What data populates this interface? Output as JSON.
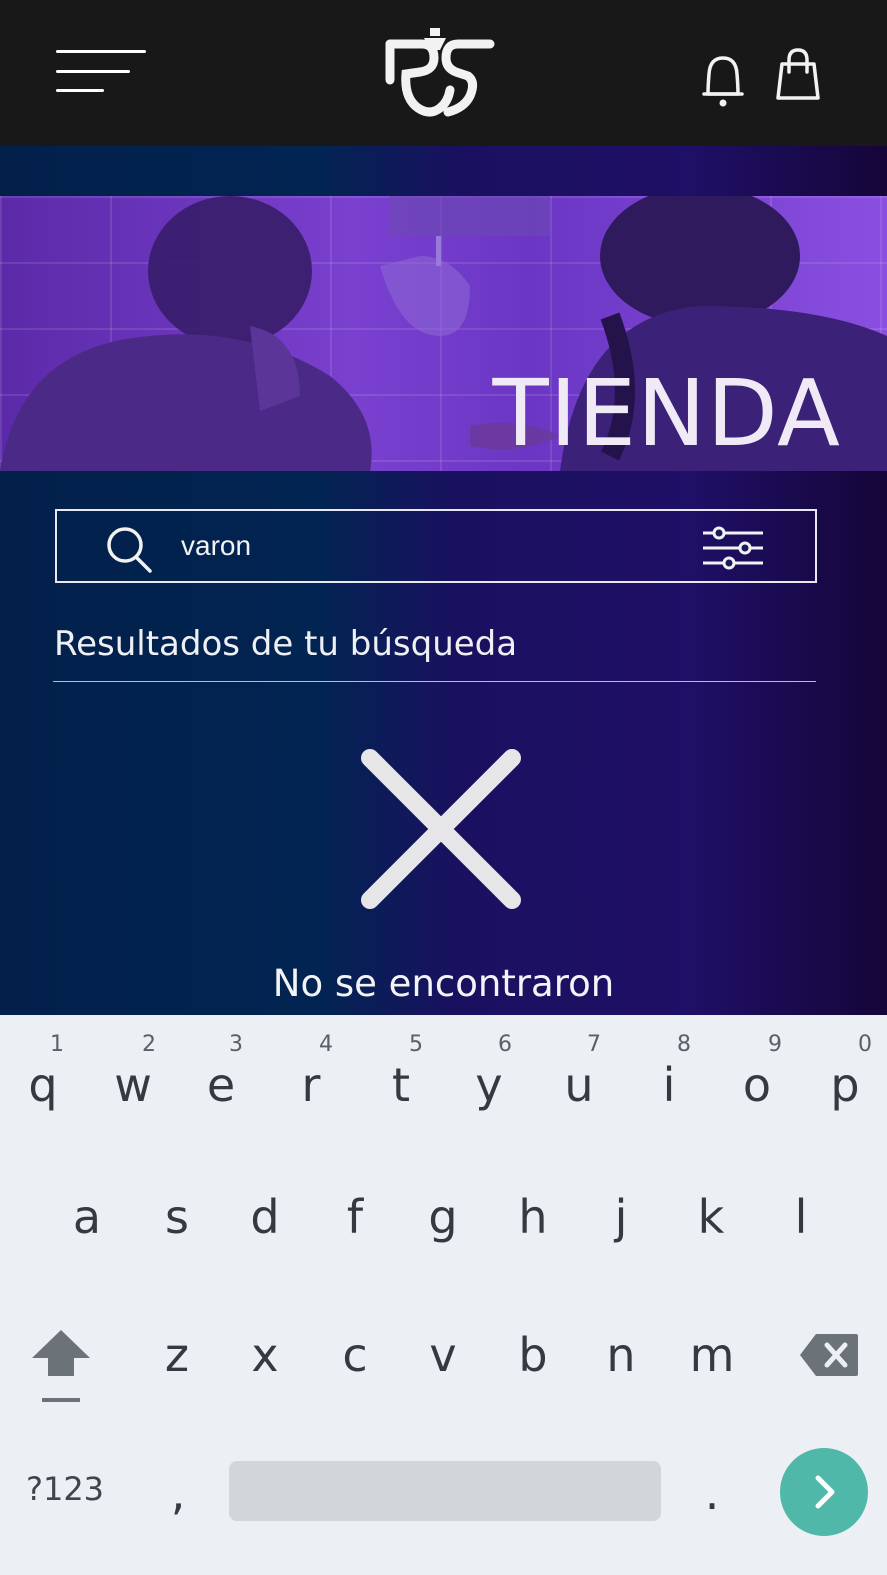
{
  "header": {
    "menu_icon": "hamburger-menu-icon",
    "logo_icon": "rs-logo",
    "notification_icon": "bell-icon",
    "cart_icon": "shopping-bag-icon"
  },
  "banner": {
    "title": "TIENDA"
  },
  "search": {
    "value": "varon",
    "search_icon": "search-icon",
    "filter_icon": "filter-sliders-icon"
  },
  "results": {
    "title": "Resultados de tu búsqueda",
    "empty_icon": "close-x-icon",
    "empty_message": "No se encontraron"
  },
  "keyboard": {
    "row1": [
      {
        "letter": "q",
        "hint": "1"
      },
      {
        "letter": "w",
        "hint": "2"
      },
      {
        "letter": "e",
        "hint": "3"
      },
      {
        "letter": "r",
        "hint": "4"
      },
      {
        "letter": "t",
        "hint": "5"
      },
      {
        "letter": "y",
        "hint": "6"
      },
      {
        "letter": "u",
        "hint": "7"
      },
      {
        "letter": "i",
        "hint": "8"
      },
      {
        "letter": "o",
        "hint": "9"
      },
      {
        "letter": "p",
        "hint": "0"
      }
    ],
    "row2": [
      "a",
      "s",
      "d",
      "f",
      "g",
      "h",
      "j",
      "k",
      "l"
    ],
    "row3": [
      "z",
      "x",
      "c",
      "v",
      "b",
      "n",
      "m"
    ],
    "symbols_label": "?123",
    "comma": ",",
    "period": ".",
    "shift_icon": "shift-arrow-icon",
    "backspace_icon": "backspace-icon",
    "go_icon": "chevron-right-icon",
    "colors": {
      "background": "#eceff3",
      "space": "#d2d6da",
      "go": "#4fb8a8",
      "key_text": "#343b40"
    }
  },
  "colors": {
    "topbar": "#181818",
    "gradient_left": "#02204a",
    "gradient_right": "#150538",
    "banner_purple": "#7a40cf"
  }
}
